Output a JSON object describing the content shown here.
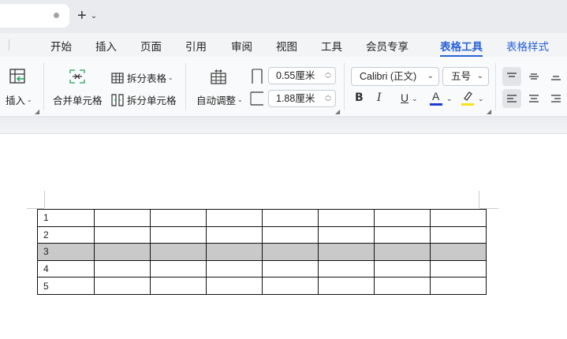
{
  "titlebar": {
    "new_tab_symbol": "+",
    "new_tab_menu_symbol": "⌄"
  },
  "menu": {
    "items": [
      "开始",
      "插入",
      "页面",
      "引用",
      "审阅",
      "视图",
      "工具",
      "会员专享",
      "表格工具",
      "表格样式"
    ],
    "active": "表格工具"
  },
  "ribbon": {
    "insert_label": "插入",
    "merge_label": "合并单元格",
    "split_table_label": "拆分表格",
    "split_cell_label": "拆分单元格",
    "autofit_label": "自动调整",
    "col_width_value": "0.55厘米",
    "row_height_value": "1.88厘米",
    "font_name": "Calibri (正文)",
    "font_size": "五号",
    "bold_label": "B",
    "italic_label": "I",
    "underline_label": "U",
    "font_color_label": "A",
    "font_color": "#1f3bd6",
    "highlight_color": "#f5e21a"
  },
  "table": {
    "rows": [
      [
        "1",
        "",
        "",
        "",
        "",
        "",
        "",
        ""
      ],
      [
        "2",
        "",
        "",
        "",
        "",
        "",
        "",
        ""
      ],
      [
        "3",
        "",
        "",
        "",
        "",
        "",
        "",
        ""
      ],
      [
        "4",
        "",
        "",
        "",
        "",
        "",
        "",
        ""
      ],
      [
        "5",
        "",
        "",
        "",
        "",
        "",
        "",
        ""
      ]
    ],
    "selected_row_index": 2
  },
  "colors": {
    "accent": "#2862d6",
    "selection": "#c9c9c9"
  }
}
